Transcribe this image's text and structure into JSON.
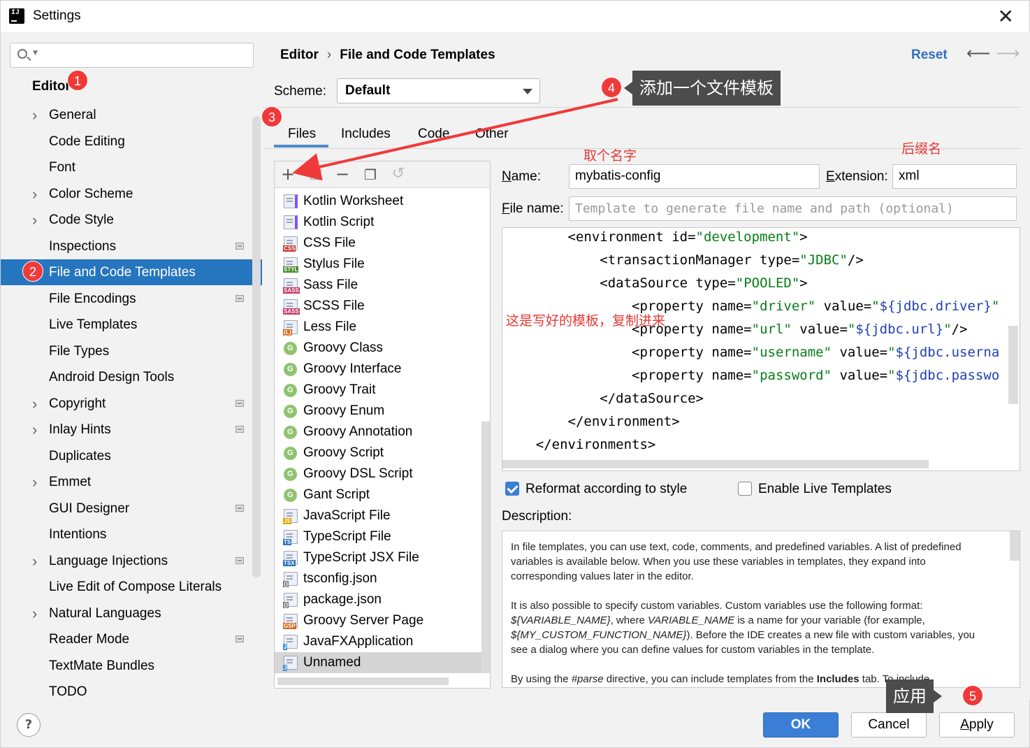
{
  "window": {
    "title": "Settings"
  },
  "sidebar": {
    "search_placeholder": "",
    "root": "Editor",
    "items": [
      {
        "label": "General",
        "expandable": true,
        "project": false
      },
      {
        "label": "Code Editing",
        "expandable": false,
        "project": false
      },
      {
        "label": "Font",
        "expandable": false,
        "project": false
      },
      {
        "label": "Color Scheme",
        "expandable": true,
        "project": false
      },
      {
        "label": "Code Style",
        "expandable": true,
        "project": false
      },
      {
        "label": "Inspections",
        "expandable": false,
        "project": true
      },
      {
        "label": "File and Code Templates",
        "expandable": false,
        "project": false,
        "selected": true
      },
      {
        "label": "File Encodings",
        "expandable": false,
        "project": true
      },
      {
        "label": "Live Templates",
        "expandable": false,
        "project": false
      },
      {
        "label": "File Types",
        "expandable": false,
        "project": false
      },
      {
        "label": "Android Design Tools",
        "expandable": false,
        "project": false
      },
      {
        "label": "Copyright",
        "expandable": true,
        "project": true
      },
      {
        "label": "Inlay Hints",
        "expandable": true,
        "project": true
      },
      {
        "label": "Duplicates",
        "expandable": false,
        "project": false
      },
      {
        "label": "Emmet",
        "expandable": true,
        "project": false
      },
      {
        "label": "GUI Designer",
        "expandable": false,
        "project": true
      },
      {
        "label": "Intentions",
        "expandable": false,
        "project": false
      },
      {
        "label": "Language Injections",
        "expandable": true,
        "project": true
      },
      {
        "label": "Live Edit of Compose Literals",
        "expandable": false,
        "project": false
      },
      {
        "label": "Natural Languages",
        "expandable": true,
        "project": false
      },
      {
        "label": "Reader Mode",
        "expandable": false,
        "project": true
      },
      {
        "label": "TextMate Bundles",
        "expandable": false,
        "project": false
      },
      {
        "label": "TODO",
        "expandable": false,
        "project": false
      }
    ]
  },
  "header": {
    "breadcrumb": [
      "Editor",
      "File and Code Templates"
    ],
    "breadcrumb_sep": "›",
    "reset_label": "Reset"
  },
  "scheme": {
    "label": "Scheme:",
    "value": "Default"
  },
  "tabs": [
    "Files",
    "Includes",
    "Code",
    "Other"
  ],
  "files": [
    {
      "name": "Kotlin Worksheet",
      "icon": "kotlin-file-icon",
      "tag": "",
      "tag_color": "#7f52ff"
    },
    {
      "name": "Kotlin Script",
      "icon": "kotlin-file-icon",
      "tag": "",
      "tag_color": "#7f52ff"
    },
    {
      "name": "CSS File",
      "icon": "css-file-icon",
      "tag": "CSS",
      "tag_color": "#c83232"
    },
    {
      "name": "Stylus File",
      "icon": "stylus-file-icon",
      "tag": "STYL",
      "tag_color": "#4b8b2d"
    },
    {
      "name": "Sass File",
      "icon": "sass-file-icon",
      "tag": "SASS",
      "tag_color": "#c83264"
    },
    {
      "name": "SCSS File",
      "icon": "scss-file-icon",
      "tag": "SASS",
      "tag_color": "#c83264"
    },
    {
      "name": "Less File",
      "icon": "less-file-icon",
      "tag": "{L}",
      "tag_color": "#d4691e"
    },
    {
      "name": "Groovy Class",
      "icon": "groovy-icon",
      "tag": "G",
      "tag_color": "#8fc370"
    },
    {
      "name": "Groovy Interface",
      "icon": "groovy-icon",
      "tag": "G",
      "tag_color": "#8fc370"
    },
    {
      "name": "Groovy Trait",
      "icon": "groovy-icon",
      "tag": "G",
      "tag_color": "#8fc370"
    },
    {
      "name": "Groovy Enum",
      "icon": "groovy-icon",
      "tag": "G",
      "tag_color": "#8fc370"
    },
    {
      "name": "Groovy Annotation",
      "icon": "groovy-icon",
      "tag": "G",
      "tag_color": "#8fc370"
    },
    {
      "name": "Groovy Script",
      "icon": "groovy-icon",
      "tag": "G",
      "tag_color": "#8fc370"
    },
    {
      "name": "Groovy DSL Script",
      "icon": "groovy-icon",
      "tag": "G",
      "tag_color": "#8fc370"
    },
    {
      "name": "Gant Script",
      "icon": "groovy-icon",
      "tag": "G",
      "tag_color": "#8fc370"
    },
    {
      "name": "JavaScript File",
      "icon": "javascript-file-icon",
      "tag": "JS",
      "tag_color": "#d8a800"
    },
    {
      "name": "TypeScript File",
      "icon": "typescript-file-icon",
      "tag": "TS",
      "tag_color": "#2f74c0"
    },
    {
      "name": "TypeScript JSX File",
      "icon": "tsx-file-icon",
      "tag": "TSX",
      "tag_color": "#2f74c0"
    },
    {
      "name": "tsconfig.json",
      "icon": "json-file-icon",
      "tag": "{}",
      "tag_color": "#777777"
    },
    {
      "name": "package.json",
      "icon": "json-file-icon",
      "tag": "{}",
      "tag_color": "#777777"
    },
    {
      "name": "Groovy Server Page",
      "icon": "gsp-file-icon",
      "tag": "GSP",
      "tag_color": "#d4691e"
    },
    {
      "name": "JavaFXApplication",
      "icon": "java-file-icon",
      "tag": "J",
      "tag_color": "#3d8fd6"
    },
    {
      "name": "Unnamed",
      "icon": "java-file-icon",
      "tag": "J",
      "tag_color": "#3d8fd6",
      "selected": true
    }
  ],
  "form": {
    "name_label": "Name:",
    "name_value": "mybatis-config",
    "ext_label": "Extension:",
    "ext_value": "xml",
    "filename_label": "File name:",
    "filename_placeholder": "Template to generate file name and path (optional)"
  },
  "code_lines": [
    {
      "indent": "        ",
      "parts": [
        [
          "t",
          "<environment id="
        ],
        [
          "s",
          "\"development\""
        ],
        [
          "t",
          ">"
        ]
      ]
    },
    {
      "indent": "            ",
      "parts": [
        [
          "t",
          "<transactionManager type="
        ],
        [
          "s",
          "\"JDBC\""
        ],
        [
          "t",
          "/>"
        ]
      ]
    },
    {
      "indent": "            ",
      "parts": [
        [
          "t",
          "<dataSource type="
        ],
        [
          "s",
          "\"POOLED\""
        ],
        [
          "t",
          ">"
        ]
      ]
    },
    {
      "indent": "                ",
      "parts": [
        [
          "t",
          "<property name="
        ],
        [
          "s",
          "\"driver\""
        ],
        [
          "t",
          " value="
        ],
        [
          "s",
          "\""
        ],
        [
          "v",
          "${jdbc.driver}"
        ],
        [
          "s",
          "\""
        ]
      ]
    },
    {
      "indent": "                ",
      "parts": [
        [
          "t",
          "<property name="
        ],
        [
          "s",
          "\"url\""
        ],
        [
          "t",
          " value="
        ],
        [
          "s",
          "\""
        ],
        [
          "v",
          "${jdbc.url}"
        ],
        [
          "s",
          "\""
        ],
        [
          "t",
          "/>"
        ]
      ]
    },
    {
      "indent": "                ",
      "parts": [
        [
          "t",
          "<property name="
        ],
        [
          "s",
          "\"username\""
        ],
        [
          "t",
          " value="
        ],
        [
          "s",
          "\""
        ],
        [
          "v",
          "${jdbc.userna"
        ]
      ]
    },
    {
      "indent": "                ",
      "parts": [
        [
          "t",
          "<property name="
        ],
        [
          "s",
          "\"password\""
        ],
        [
          "t",
          " value="
        ],
        [
          "s",
          "\""
        ],
        [
          "v",
          "${jdbc.passwo"
        ]
      ]
    },
    {
      "indent": "            ",
      "parts": [
        [
          "t",
          "</dataSource>"
        ]
      ]
    },
    {
      "indent": "        ",
      "parts": [
        [
          "t",
          "</environment>"
        ]
      ]
    },
    {
      "indent": "    ",
      "parts": [
        [
          "t",
          "</environments>"
        ]
      ]
    }
  ],
  "options": {
    "reformat_label": "Reformat according to style",
    "reformat_checked": true,
    "live_label": "Enable Live Templates",
    "live_checked": false
  },
  "description": {
    "label": "Description:",
    "p1": "In file templates, you can use text, code, comments, and predefined variables. A list of predefined variables is available below. When you use these variables in templates, they expand into corresponding values later in the editor.",
    "p2_a": "It is also possible to specify custom variables. Custom variables use the following format: ",
    "p2_var1": "${VARIABLE_NAME}",
    "p2_b": ", where ",
    "p2_var2": "VARIABLE_NAME",
    "p2_c": " is a name for your variable (for example, ",
    "p2_var3": "${MY_CUSTOM_FUNCTION_NAME}",
    "p2_d": "). Before the IDE creates a new file with custom variables, you see a dialog where you can define values for custom variables in the template.",
    "p3_a": "By using the ",
    "p3_parse": "#parse",
    "p3_b": " directive, you can include templates from the ",
    "p3_inc": "Includes",
    "p3_c": " tab. To include"
  },
  "buttons": {
    "ok": "OK",
    "cancel": "Cancel",
    "apply": "Apply"
  },
  "annotations": {
    "b1": "1",
    "b2": "2",
    "b3": "3",
    "b4": "4",
    "b5": "5",
    "callout_add": "添加一个文件模板",
    "note_name": "取个名字",
    "note_ext": "后缀名",
    "note_template": "这是写好的模板，复制进来",
    "callout_apply": "应用",
    "color": "#f03a3a"
  }
}
